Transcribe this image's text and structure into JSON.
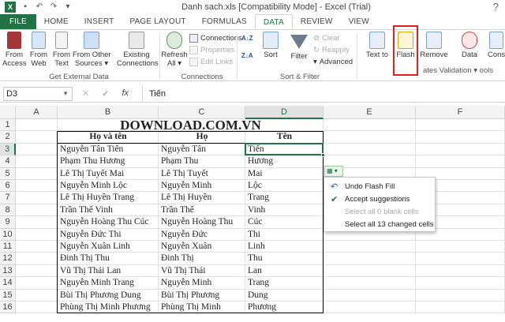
{
  "titlebar": {
    "title": "Danh sach.xls  [Compatibility Mode] - Excel (Trial)",
    "app_icon": "X",
    "window_control": "?"
  },
  "tabs": [
    "FILE",
    "HOME",
    "INSERT",
    "PAGE LAYOUT",
    "FORMULAS",
    "DATA",
    "REVIEW",
    "VIEW"
  ],
  "active_tab": "DATA",
  "ribbon": {
    "get_external": {
      "from_access": "From\nAccess",
      "from_web": "From\nWeb",
      "from_text": "From\nText",
      "from_other": "From Other\nSources ▾",
      "existing": "Existing\nConnections",
      "label": "Get External Data"
    },
    "connections": {
      "refresh": "Refresh\nAll ▾",
      "connections": "Connections",
      "properties": "Properties",
      "edit_links": "Edit Links",
      "label": "Connections"
    },
    "sort_filter": {
      "sort": "Sort",
      "filter": "Filter",
      "clear": "Clear",
      "reapply": "Reapply",
      "advanced": "Advanced",
      "label": "Sort & Filter"
    },
    "data_tools": {
      "text_to": "Text to",
      "flash": "Flash",
      "remove": "Remove",
      "data": "Data",
      "validation": "Validation ▾",
      "consolidate": "Conso",
      "label_partial": "ates  Validation ▾  ools"
    }
  },
  "formula_bar": {
    "name_box": "D3",
    "cancel": "✕",
    "enter": "✓",
    "fx": "fx",
    "value": "Tiến"
  },
  "columns": [
    "A",
    "B",
    "C",
    "D",
    "E",
    "F"
  ],
  "rows": [
    "1",
    "2",
    "3",
    "4",
    "5",
    "6",
    "7",
    "8",
    "9",
    "10",
    "11",
    "12",
    "13",
    "14",
    "15",
    "16"
  ],
  "sheet": {
    "title": "DOWNLOAD.COM.VN",
    "headers": [
      "Họ và tên",
      "Họ",
      "Tên"
    ],
    "data": [
      [
        "Nguyễn Tân Tiến",
        "Nguyễn Tân",
        "Tiến"
      ],
      [
        "Phạm Thu Hương",
        "Phạm Thu",
        "Hương"
      ],
      [
        "Lê Thị Tuyết Mai",
        "Lê Thị Tuyết",
        "Mai"
      ],
      [
        "Nguyễn Minh Lộc",
        "Nguyễn Minh",
        "Lộc"
      ],
      [
        "Lê Thị Huyền Trang",
        "Lê Thị Huyền",
        "Trang"
      ],
      [
        "Trần Thế Vinh",
        "Trần Thế",
        "Vinh"
      ],
      [
        "Nguyễn Hoàng Thu Cúc",
        "Nguyễn Hoàng Thu",
        "Cúc"
      ],
      [
        "Nguyễn Đức Thi",
        "Nguyễn Đức",
        "Thi"
      ],
      [
        "Nguyễn Xuân Linh",
        "Nguyễn Xuân",
        "Linh"
      ],
      [
        "Đinh Thị Thu",
        "Đinh Thị",
        "Thu"
      ],
      [
        "Vũ Thị Thái Lan",
        "Vũ Thị Thái",
        "Lan"
      ],
      [
        "Nguyễn Minh Trang",
        "Nguyễn Minh",
        "Trang"
      ],
      [
        "Bùi Thị Phương Dung",
        "Bùi Thị Phương",
        "Dung"
      ],
      [
        "Phùng Thị Minh Phương",
        "Phùng Thị Minh",
        "Phương"
      ]
    ]
  },
  "flash_menu": {
    "undo": "Undo Flash Fill",
    "accept": "Accept suggestions",
    "select_blank": "Select all 0 blank cells",
    "select_changed": "Select all 13 changed cells"
  },
  "colors": {
    "excel_green": "#217346",
    "highlight_red": "#e02020"
  }
}
